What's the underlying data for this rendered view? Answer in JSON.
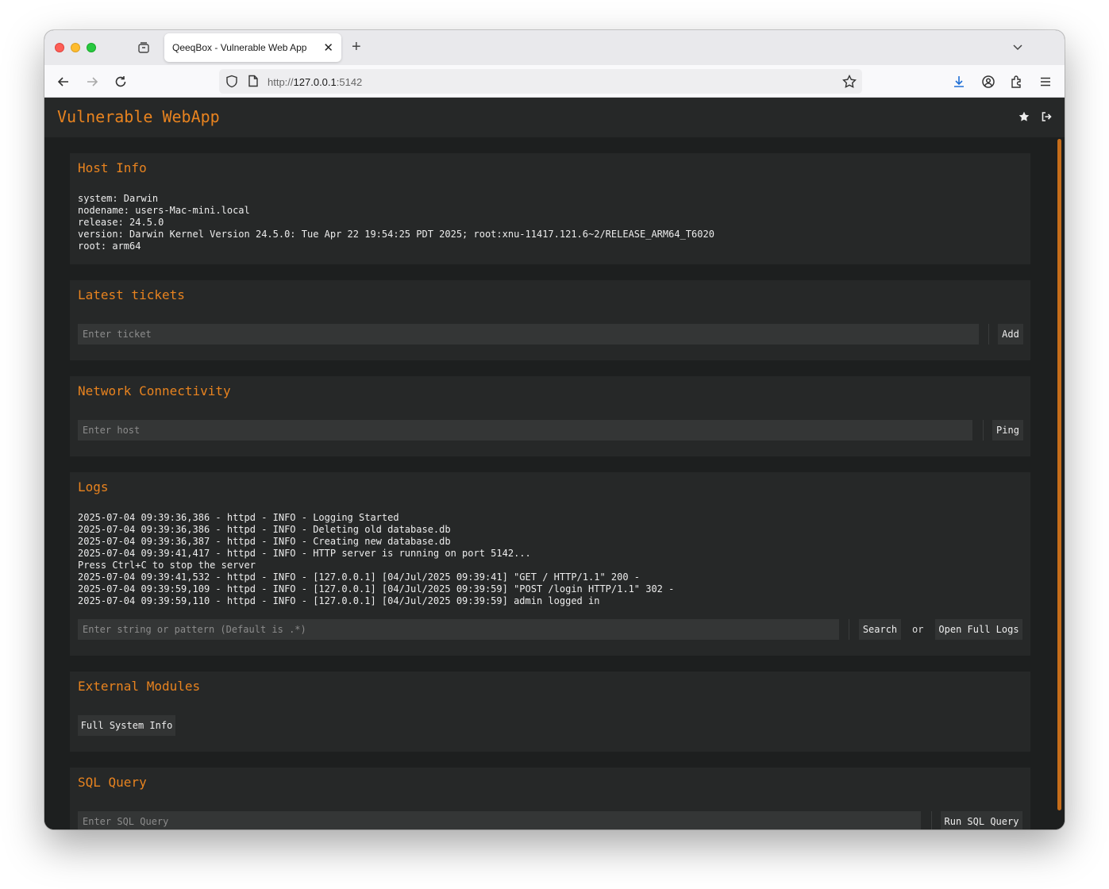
{
  "browser": {
    "tab_title": "QeeqBox - Vulnerable Web App",
    "url_scheme": "http://",
    "url_host": "127.0.0.1",
    "url_port": ":5142"
  },
  "app": {
    "brand": "Vulnerable WebApp",
    "accent_color": "#e8831f"
  },
  "host_info": {
    "title": "Host Info",
    "text": "system: Darwin\nnodename: users-Mac-mini.local\nrelease: 24.5.0\nversion: Darwin Kernel Version 24.5.0: Tue Apr 22 19:54:25 PDT 2025; root:xnu-11417.121.6~2/RELEASE_ARM64_T6020\nroot: arm64"
  },
  "tickets": {
    "title": "Latest tickets",
    "placeholder": "Enter ticket",
    "button": "Add"
  },
  "network": {
    "title": "Network Connectivity",
    "placeholder": "Enter host",
    "button": "Ping"
  },
  "logs": {
    "title": "Logs",
    "text": "2025-07-04 09:39:36,386 - httpd - INFO - Logging Started\n2025-07-04 09:39:36,386 - httpd - INFO - Deleting old database.db\n2025-07-04 09:39:36,387 - httpd - INFO - Creating new database.db\n2025-07-04 09:39:41,417 - httpd - INFO - HTTP server is running on port 5142...\nPress Ctrl+C to stop the server\n2025-07-04 09:39:41,532 - httpd - INFO - [127.0.0.1] [04/Jul/2025 09:39:41] \"GET / HTTP/1.1\" 200 -\n2025-07-04 09:39:59,109 - httpd - INFO - [127.0.0.1] [04/Jul/2025 09:39:59] \"POST /login HTTP/1.1\" 302 -\n2025-07-04 09:39:59,110 - httpd - INFO - [127.0.0.1] [04/Jul/2025 09:39:59] admin logged in",
    "placeholder": "Enter string or pattern (Default is .*)",
    "search_button": "Search",
    "or_text": "or",
    "open_full_button": "Open Full Logs"
  },
  "modules": {
    "title": "External Modules",
    "button": "Full System Info"
  },
  "sql": {
    "title": "SQL Query",
    "placeholder": "Enter SQL Query",
    "button": "Run SQL Query"
  },
  "icons": {
    "header_right": [
      "star-icon",
      "logout-icon"
    ],
    "toolbar": [
      "back-icon",
      "forward-icon",
      "reload-icon",
      "shield-icon",
      "page-icon",
      "bookmark-star-icon",
      "download-icon",
      "account-icon",
      "extensions-icon",
      "menu-icon"
    ]
  }
}
